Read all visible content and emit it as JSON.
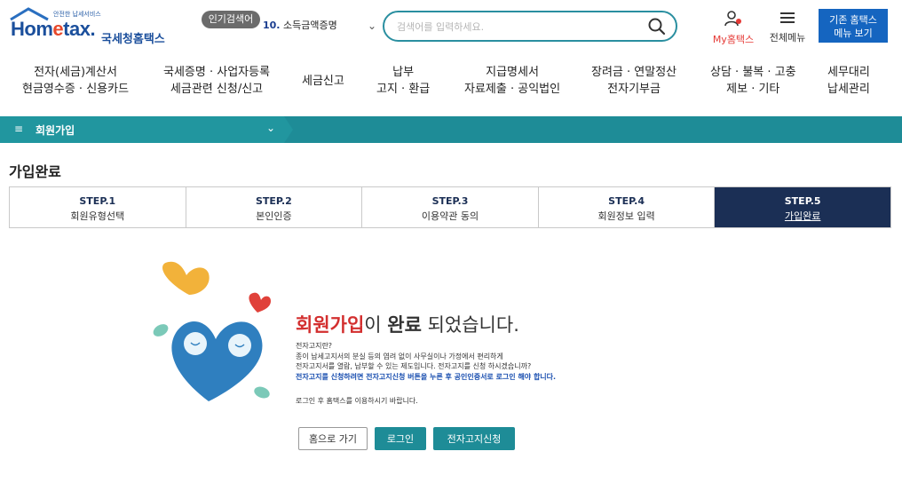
{
  "header": {
    "logo_tagline": "안전한 납세서비스",
    "logo_word_pre": "Hom",
    "logo_word_e": "e",
    "logo_word_post": "tax.",
    "logo_kr": "국세청홈택스",
    "popular_badge": "인기검색어",
    "popular_num": "10.",
    "popular_term": "소득금액증명",
    "search_placeholder": "검색어를 입력하세요.",
    "my_hometax": "My홈택스",
    "all_menu": "전체메뉴",
    "old_menu_line1": "기존 홈택스",
    "old_menu_line2": "메뉴 보기"
  },
  "gnb": [
    {
      "line1": "전자(세금)계산서",
      "line2": "현금영수증 · 신용카드"
    },
    {
      "line1": "국세증명 · 사업자등록",
      "line2": "세금관련 신청/신고"
    },
    {
      "line1": "세금신고",
      "line2": ""
    },
    {
      "line1": "납부",
      "line2": "고지 · 환급"
    },
    {
      "line1": "지급명세서",
      "line2": "자료제출 · 공익법인"
    },
    {
      "line1": "장려금 · 연말정산",
      "line2": "전자기부금"
    },
    {
      "line1": "상담 · 불복 · 고충",
      "line2": "제보 · 기타"
    },
    {
      "line1": "세무대리",
      "line2": "납세관리"
    }
  ],
  "breadcrumb": {
    "label": "회원가입"
  },
  "page_title": "가입완료",
  "steps": [
    {
      "num": "STEP.1",
      "label": "회원유형선택"
    },
    {
      "num": "STEP.2",
      "label": "본인인증"
    },
    {
      "num": "STEP.3",
      "label": "이용약관 동의"
    },
    {
      "num": "STEP.4",
      "label": "회원정보 입력"
    },
    {
      "num": "STEP.5",
      "label": "가입완료"
    }
  ],
  "complete": {
    "msg_red": "회원가입",
    "msg_mid": "이 ",
    "msg_bold": "완료",
    "msg_end": " 되었습니다.",
    "info1": "전자고지란?",
    "info2": "종이 납세고지서의 분실 등의 염려 없이 사무실이나 가정에서 편리하게",
    "info3": "전자고지서를 열람, 납부할 수 있는 제도입니다. 전자고지를 신청 하시겠습니까?",
    "info4": "전자고지를 신청하려면 전자고지신청 버튼을 누른 후 공인인증서로 로그인 해야 합니다.",
    "info5": "로그인 후 홈택스를 이용하시기 바랍니다."
  },
  "buttons": {
    "home": "홈으로 가기",
    "login": "로그인",
    "ebill": "전자고지신청"
  },
  "colors": {
    "teal": "#1e8c97",
    "navy": "#1b2f55",
    "brand_blue": "#1565c0",
    "red": "#d32f2f"
  }
}
